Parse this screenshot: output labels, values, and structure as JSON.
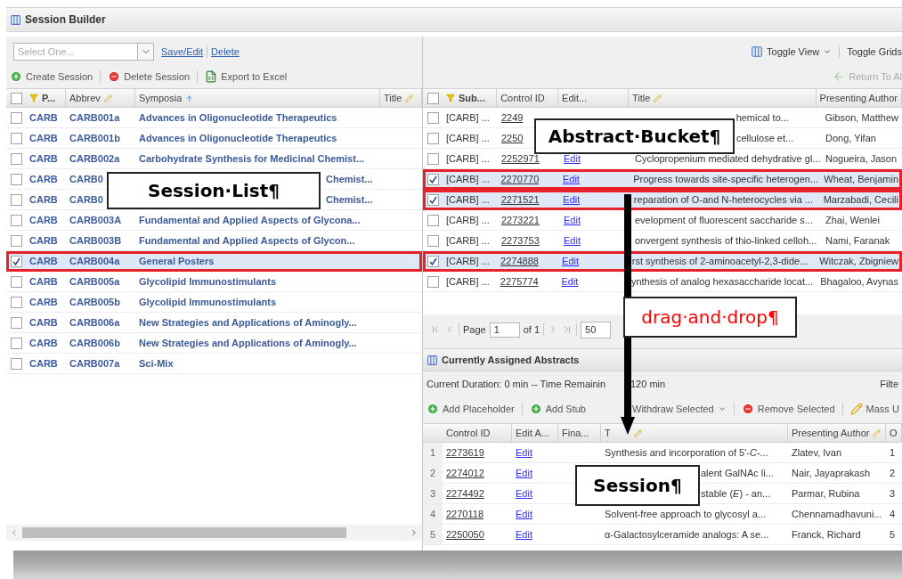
{
  "window": {
    "title": "Session Builder"
  },
  "session_panel": {
    "select": {
      "placeholder": "Select One..."
    },
    "links": [
      "Save/Edit",
      "Delete"
    ],
    "toolbar": [
      {
        "label": "Create Session"
      },
      {
        "label": "Delete Session"
      },
      {
        "label": "Export to Excel"
      }
    ],
    "all_checked": false,
    "columns": [
      {
        "label": "P...",
        "filter": true,
        "editable": false,
        "sorted": false
      },
      {
        "label": "Abbrev",
        "filter": false,
        "editable": true,
        "sorted": false
      },
      {
        "label": "Symposia",
        "filter": false,
        "editable": false,
        "sorted": true
      },
      {
        "label": "Title",
        "filter": false,
        "editable": true,
        "sorted": false
      }
    ],
    "rows": [
      {
        "checked": false,
        "highlighted": false,
        "cells": [
          "CARB",
          "CARB001a",
          "Advances in Oligonucleotide Therapeutics"
        ]
      },
      {
        "checked": false,
        "highlighted": false,
        "cells": [
          "CARB",
          "CARB001b",
          "Advances in Oligonucleotide Therapeutics"
        ]
      },
      {
        "checked": false,
        "highlighted": false,
        "cells": [
          "CARB",
          "CARB002a",
          "Carbohydrate Synthesis for Medicinal Chemist..."
        ]
      },
      {
        "checked": false,
        "highlighted": false,
        "cells": [
          "CARB",
          "CARB0",
          "Chemist..."
        ]
      },
      {
        "checked": false,
        "highlighted": false,
        "cells": [
          "CARB",
          "CARB0",
          "Chemist..."
        ]
      },
      {
        "checked": false,
        "highlighted": false,
        "cells": [
          "CARB",
          "CARB003A",
          "Fundamental and Applied Aspects of Glycona..."
        ]
      },
      {
        "checked": false,
        "highlighted": false,
        "cells": [
          "CARB",
          "CARB003B",
          "Fundamental and Applied Aspects of Glycon..."
        ]
      },
      {
        "checked": true,
        "highlighted": true,
        "cells": [
          "CARB",
          "CARB004a",
          "General Posters"
        ]
      },
      {
        "checked": false,
        "highlighted": false,
        "cells": [
          "CARB",
          "CARB005a",
          "Glycolipid Immunostimulants"
        ]
      },
      {
        "checked": false,
        "highlighted": false,
        "cells": [
          "CARB",
          "CARB005b",
          "Glycolipid Immunostimulants"
        ]
      },
      {
        "checked": false,
        "highlighted": false,
        "cells": [
          "CARB",
          "CARB006a",
          "New Strategies and Applications of Aminogly..."
        ]
      },
      {
        "checked": false,
        "highlighted": false,
        "cells": [
          "CARB",
          "CARB006b",
          "New Strategies and Applications of Aminogly..."
        ]
      },
      {
        "checked": false,
        "highlighted": false,
        "cells": [
          "CARB",
          "CARB007a",
          "Sci-Mix"
        ]
      }
    ]
  },
  "bucket_panel": {
    "view_buttons": [
      {
        "label": "Toggle View",
        "dropdown": true
      },
      {
        "label": "Toggle Grids",
        "dropdown": false
      }
    ],
    "return_button": {
      "label": "Return To Al",
      "disabled": true
    },
    "all_checked": false,
    "columns": [
      {
        "label": "Sub...",
        "filter": true,
        "editable": false
      },
      {
        "label": "Control ID",
        "filter": false,
        "editable": false
      },
      {
        "label": "Edit...",
        "filter": false,
        "editable": false
      },
      {
        "label": "Title",
        "filter": false,
        "editable": true
      },
      {
        "label": "Presenting Author",
        "filter": false,
        "editable": false
      }
    ],
    "rows": [
      {
        "checked": false,
        "highlighted": false,
        "cells": [
          "[CARB] ...",
          "2249",
          null,
          "hemical to...",
          "Gibson, Matthew"
        ]
      },
      {
        "checked": false,
        "highlighted": false,
        "cells": [
          "[CARB] ...",
          "2250",
          null,
          "cellulose et...",
          "Dong, Yifan"
        ]
      },
      {
        "checked": false,
        "highlighted": false,
        "cells": [
          "[CARB] ...",
          "2252971",
          "Edit",
          "Cyclopropenium mediated dehydrative gl...",
          "Nogueira, Jason"
        ]
      },
      {
        "checked": true,
        "highlighted": true,
        "cells": [
          "[CARB] ...",
          "2270770",
          "Edit",
          "Progress towards site-specific heterogen...",
          "Wheat, Benjamin"
        ]
      },
      {
        "checked": true,
        "highlighted": true,
        "cells": [
          "[CARB] ...",
          "2271521",
          "Edit",
          "reparation of O-and N-heterocycles via ...",
          "Marzabadi, Cecili"
        ]
      },
      {
        "checked": false,
        "highlighted": false,
        "cells": [
          "[CARB] ...",
          "2273221",
          "Edit",
          "evelopment of fluorescent saccharide s...",
          "Zhai, Wenlei"
        ]
      },
      {
        "checked": false,
        "highlighted": false,
        "cells": [
          "[CARB] ...",
          "2273753",
          "Edit",
          "onvergent synthesis of thio-linked celloh...",
          "Nami, Faranak"
        ]
      },
      {
        "checked": true,
        "highlighted": true,
        "cells": [
          "[CARB] ...",
          "2274888",
          "Edit",
          "rst synthesis of 2-aminoacetyl-2,3-dide...",
          "Witczak, Zbigniew"
        ]
      },
      {
        "checked": false,
        "highlighted": false,
        "cells": [
          "[CARB] ...",
          "2275774",
          "Edit",
          "ynthesis of analog hexasaccharide locat...",
          "Bhagaloo, Avynas"
        ]
      }
    ],
    "pager": {
      "page_label": "Page",
      "page": "1",
      "of": "of 1",
      "page_size": "50"
    }
  },
  "assigned_panel": {
    "title": "Currently Assigned Abstracts",
    "duration": [
      "Current Duration: 0 min -- Time Remainin",
      "120 min"
    ],
    "filter_label": "Filte",
    "toolbar": [
      {
        "label": "Add Placeholder",
        "dropdown": false
      },
      {
        "label": "Add Stub",
        "dropdown": false
      },
      {
        "label": "Withdraw Selected",
        "dropdown": true
      },
      {
        "label": "Remove Selected",
        "dropdown": false
      },
      {
        "label": "Mass U",
        "dropdown": false
      }
    ],
    "columns": [
      {
        "label": "Control ID",
        "editable": false
      },
      {
        "label": "Edit A...",
        "editable": false
      },
      {
        "label": "Fina...",
        "editable": false
      },
      {
        "label": "T",
        "editable": true
      },
      {
        "label": "Presenting Author",
        "editable": true
      },
      {
        "label": "O",
        "editable": false
      }
    ],
    "rows": [
      {
        "number": "1",
        "cells": [
          "2273619",
          "Edit",
          null,
          "Synthesis and incorporation of 5'-*C*-...",
          "Zlatev, Ivan",
          "1"
        ]
      },
      {
        "number": "2",
        "cells": [
          "2274012",
          "Edit",
          null,
          "alent GalNAc li...",
          "Nair, Jayaprakash",
          "2"
        ]
      },
      {
        "number": "3",
        "cells": [
          "2274492",
          "Edit",
          null,
          "stable (*E*) - an...",
          "Parmar, Rubina",
          "3"
        ]
      },
      {
        "number": "4",
        "cells": [
          "2270118",
          "Edit",
          null,
          "Solvent-free approach to glycosyl a...",
          "Chennamadhavuni...",
          "4"
        ]
      },
      {
        "number": "5",
        "cells": [
          "2250050",
          "Edit",
          null,
          "α-Galactosylceramide analogs: A se...",
          "Franck, Richard",
          "5"
        ]
      }
    ]
  },
  "annotations": [
    {
      "text": "Session·List¶",
      "color": "#000000"
    },
    {
      "text": "Abstract·Bucket¶",
      "color": "#000000"
    },
    {
      "text": "drag·and·drop¶",
      "color": "#ff0000"
    },
    {
      "text": "Session¶",
      "color": "#000000"
    }
  ]
}
